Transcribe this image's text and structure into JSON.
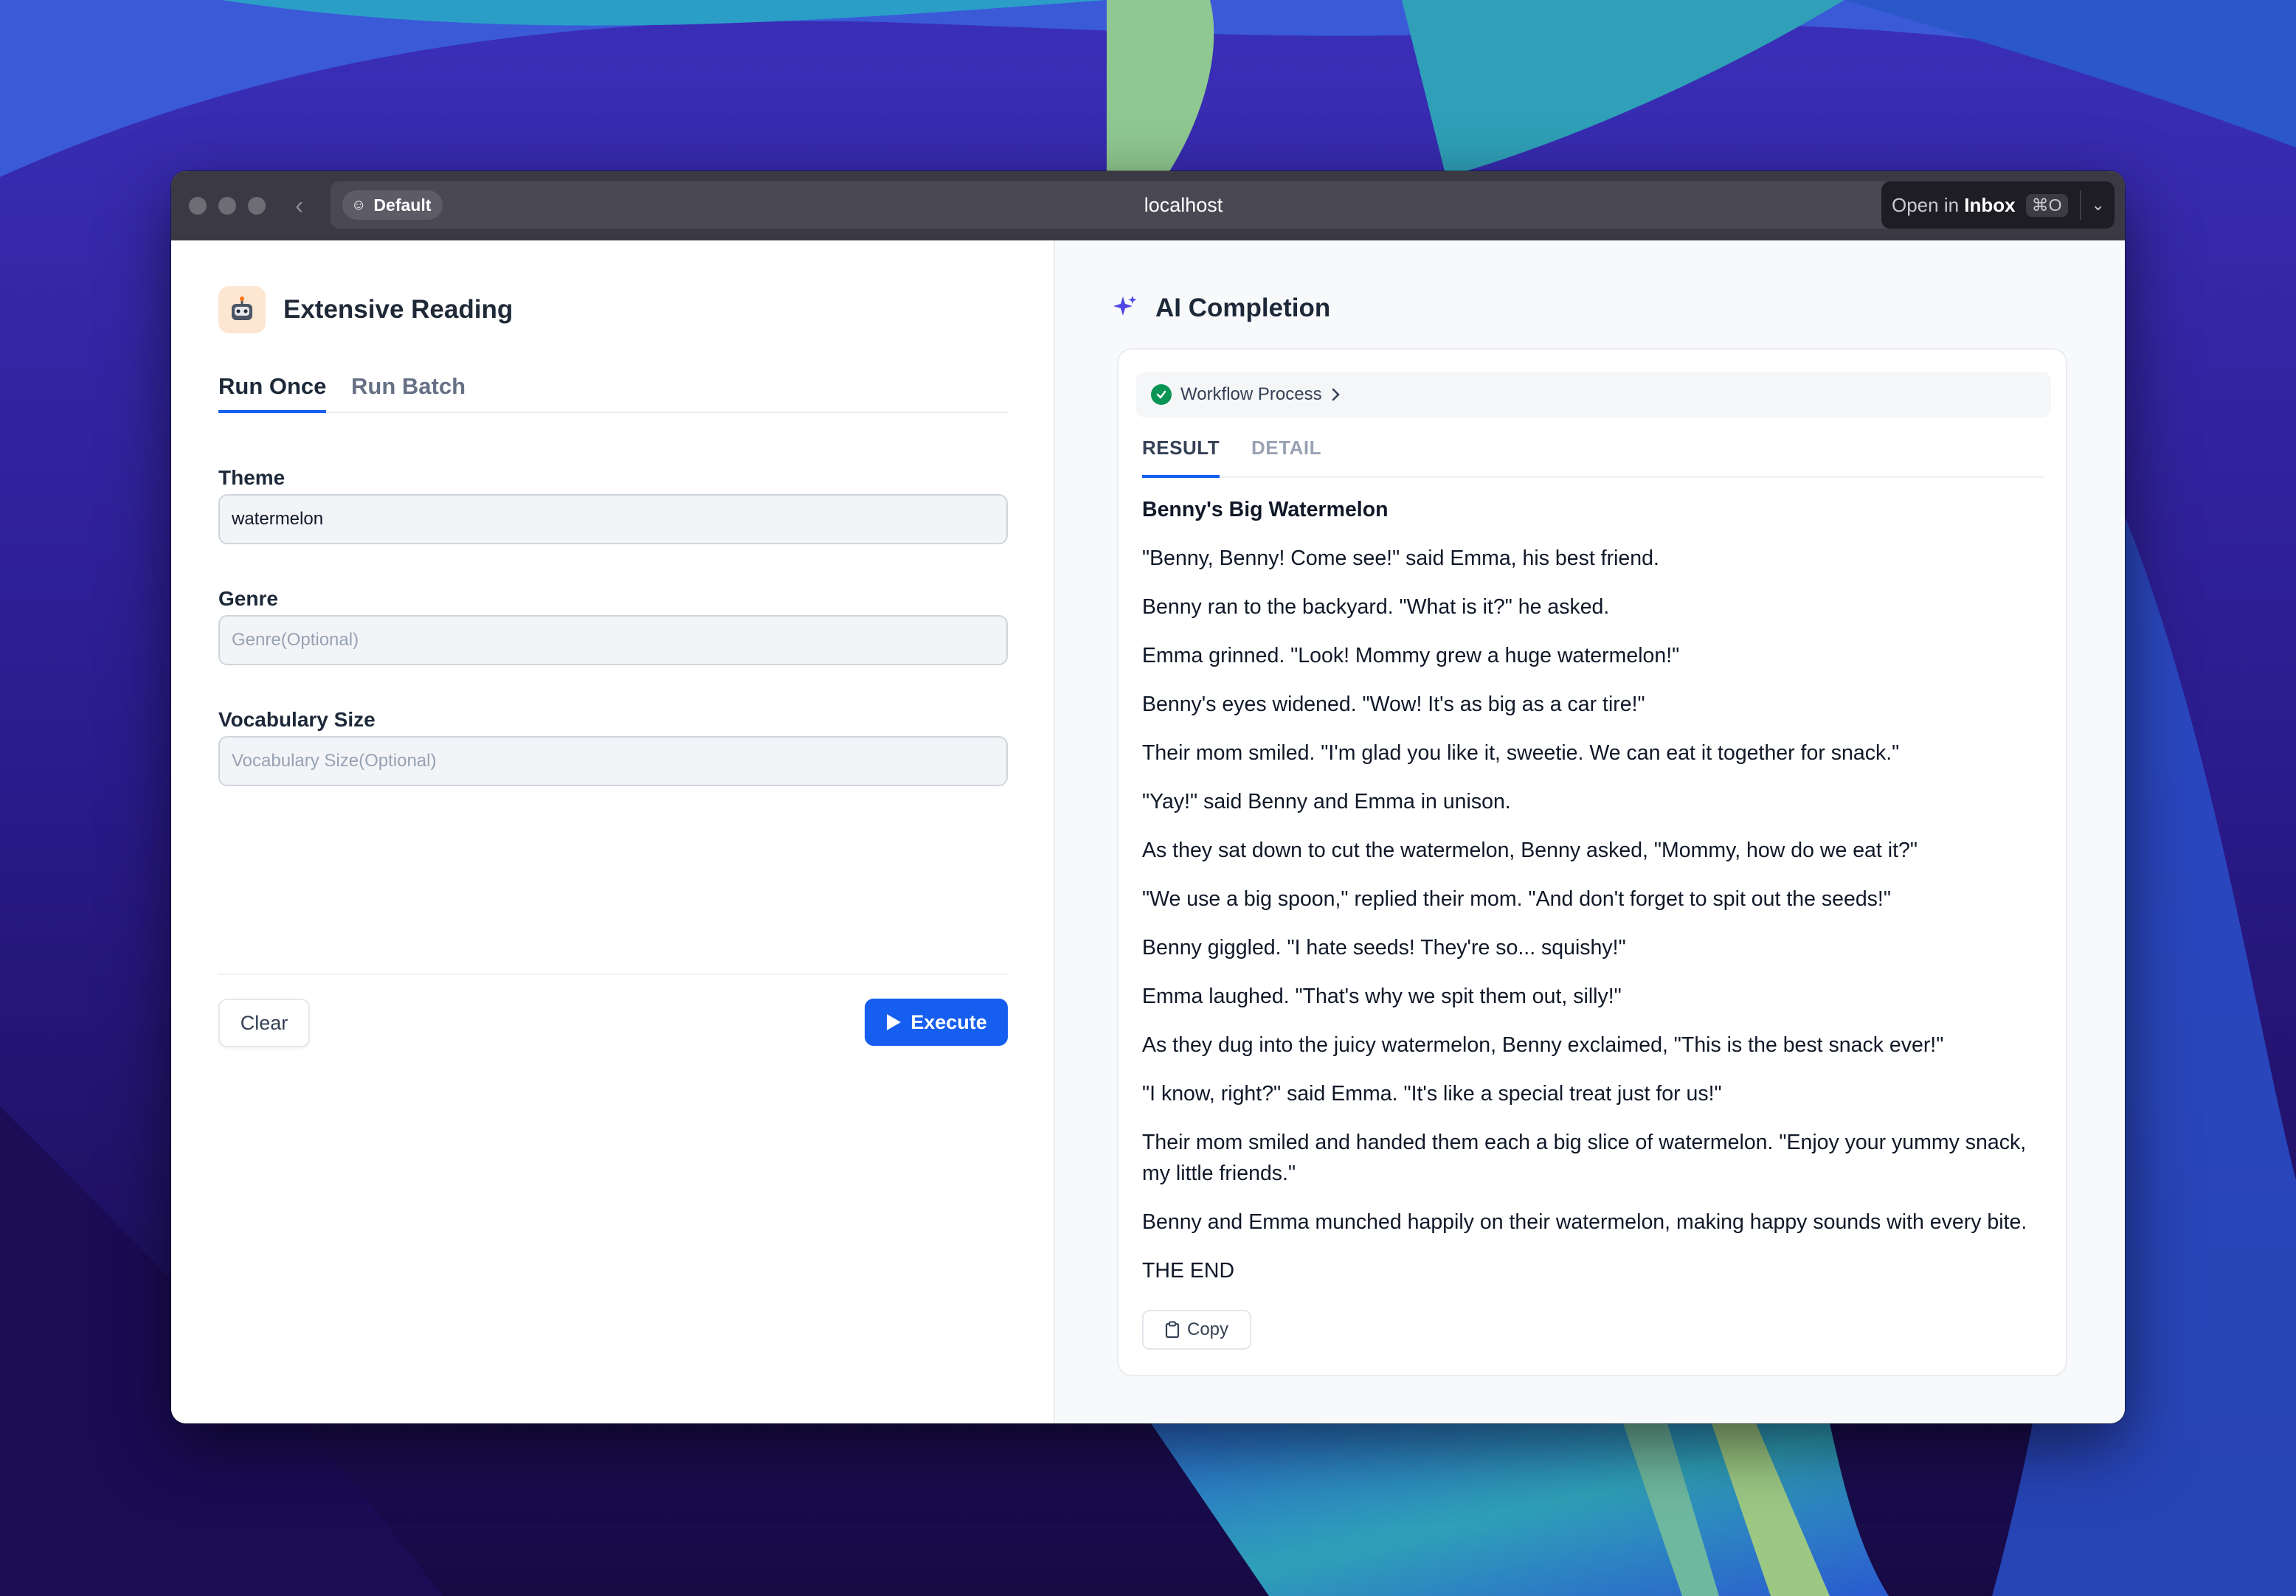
{
  "browser": {
    "profile_label": "Default",
    "url": "localhost",
    "open_in": {
      "prefix": "Open in ",
      "app": "Inbox",
      "shortcut": "⌘O"
    }
  },
  "left": {
    "app_title": "Extensive Reading",
    "tabs": [
      {
        "label": "Run Once",
        "active": true
      },
      {
        "label": "Run Batch",
        "active": false
      }
    ],
    "fields": [
      {
        "label": "Theme",
        "value": "watermelon",
        "placeholder": ""
      },
      {
        "label": "Genre",
        "value": "",
        "placeholder": "Genre(Optional)"
      },
      {
        "label": "Vocabulary Size",
        "value": "",
        "placeholder": "Vocabulary Size(Optional)"
      }
    ],
    "clear_label": "Clear",
    "execute_label": "Execute"
  },
  "right": {
    "title": "AI Completion",
    "workflow_label": "Workflow Process",
    "tabs": [
      {
        "label": "RESULT",
        "active": true
      },
      {
        "label": "DETAIL",
        "active": false
      }
    ],
    "story_title": "Benny's Big Watermelon",
    "paragraphs": [
      "\"Benny, Benny! Come see!\" said Emma, his best friend.",
      "Benny ran to the backyard. \"What is it?\" he asked.",
      "Emma grinned. \"Look! Mommy grew a huge watermelon!\"",
      "Benny's eyes widened. \"Wow! It's as big as a car tire!\"",
      "Their mom smiled. \"I'm glad you like it, sweetie. We can eat it together for snack.\"",
      "\"Yay!\" said Benny and Emma in unison.",
      "As they sat down to cut the watermelon, Benny asked, \"Mommy, how do we eat it?\"",
      "\"We use a big spoon,\" replied their mom. \"And don't forget to spit out the seeds!\"",
      "Benny giggled. \"I hate seeds! They're so... squishy!\"",
      "Emma laughed. \"That's why we spit them out, silly!\"",
      "As they dug into the juicy watermelon, Benny exclaimed, \"This is the best snack ever!\"",
      "\"I know, right?\" said Emma. \"It's like a special treat just for us!\"",
      "Their mom smiled and handed them each a big slice of watermelon. \"Enjoy your yummy snack, my little friends.\"",
      "Benny and Emma munched happily on their watermelon, making happy sounds with every bite.",
      "THE END"
    ],
    "copy_label": "Copy"
  },
  "colors": {
    "accent": "#155eef",
    "success": "#079455",
    "titlebar": "#3b3a44"
  },
  "icons": [
    "back-arrow-icon",
    "profile-face-icon",
    "share-icon",
    "link-icon",
    "chevron-down-icon",
    "robot-icon",
    "sparkle-icon",
    "check-circle-icon",
    "chevron-right-icon",
    "play-icon",
    "clipboard-icon"
  ]
}
